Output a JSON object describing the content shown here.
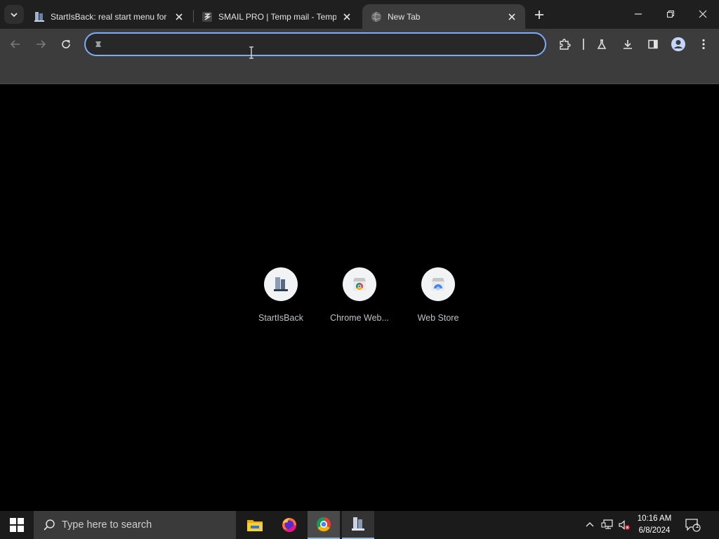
{
  "browser": {
    "tabs": [
      {
        "title": "StartIsBack: real start menu for Windows",
        "favicon": "startisback-favicon",
        "active": false
      },
      {
        "title": "SMAIL PRO | Temp mail - Temporary email",
        "favicon": "smail-favicon",
        "active": false
      },
      {
        "title": "New Tab",
        "favicon": "globe-favicon",
        "active": true
      }
    ],
    "omnibox": {
      "value": "",
      "placeholder": ""
    },
    "colors": {
      "frame": "#1f1f1f",
      "toolbar": "#3c3c3c",
      "omnibox_focus": "#7cacf8",
      "content_bg": "#000000"
    }
  },
  "new_tab": {
    "shortcuts": [
      {
        "label": "StartIsBack",
        "icon": "startisback-icon"
      },
      {
        "label": "Chrome Web...",
        "icon": "chrome-web-store-icon"
      },
      {
        "label": "Web Store",
        "icon": "web-store-icon"
      }
    ]
  },
  "taskbar": {
    "search_placeholder": "Type here to search",
    "apps": [
      "file-explorer-icon",
      "firefox-icon",
      "chrome-icon",
      "startisback-icon"
    ],
    "clock": {
      "time": "10:16 AM",
      "date": "6/8/2024"
    },
    "notification_count": "1"
  }
}
